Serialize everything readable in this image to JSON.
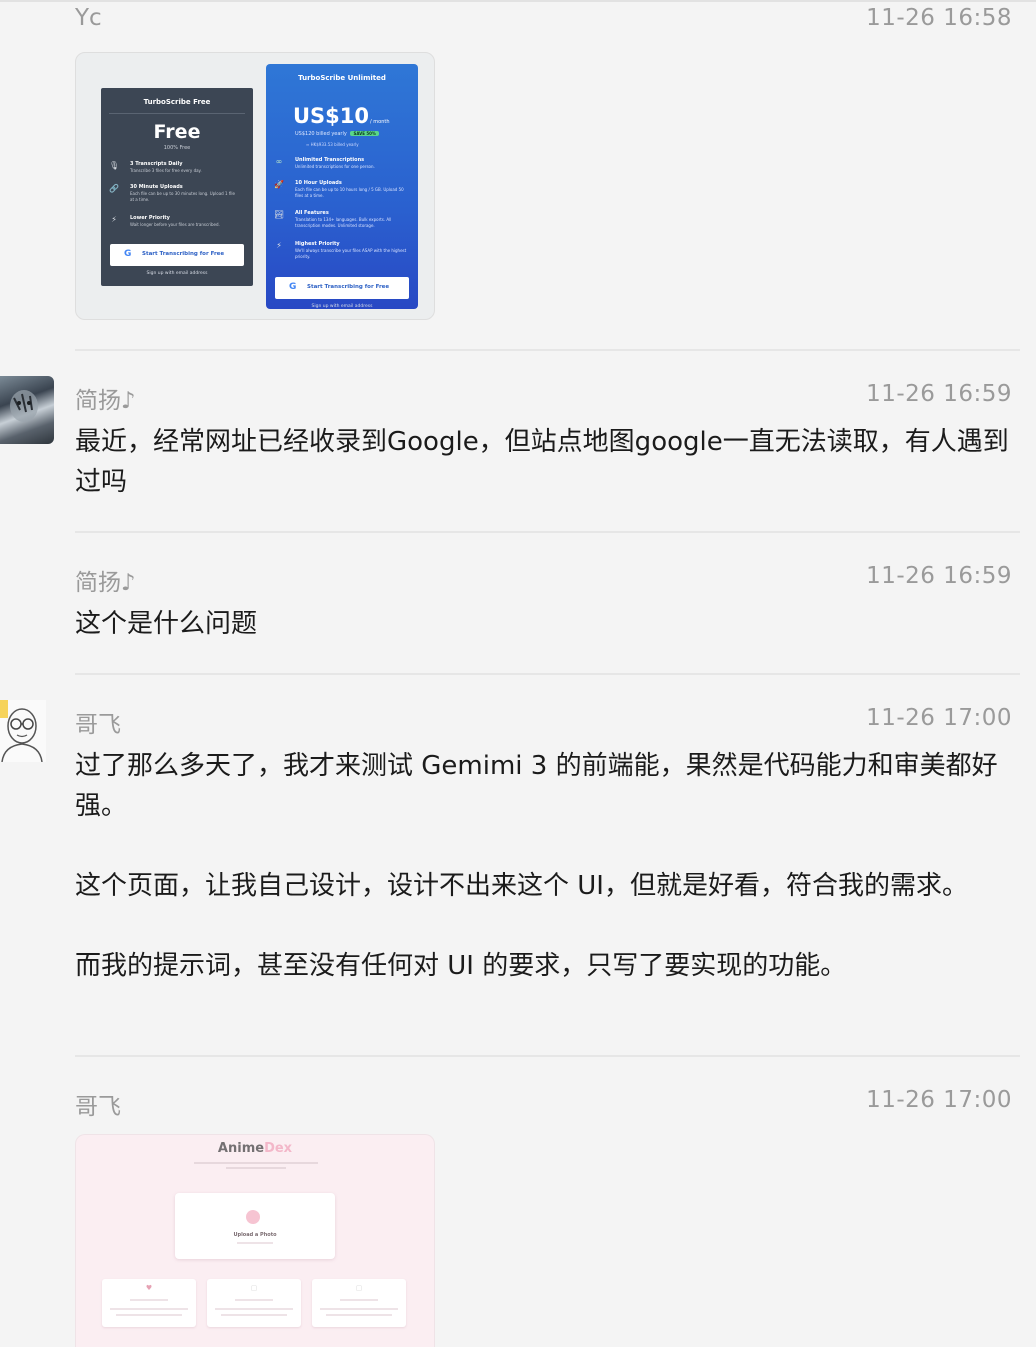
{
  "messages": [
    {
      "sender": "Yc",
      "time": "11-26 16:58",
      "image": {
        "free_card": {
          "title": "TurboScribe Free",
          "plan": "Free",
          "subtitle": "100% Free",
          "features": [
            {
              "icon": "microphone-icon",
              "glyph": "🎙",
              "title": "3 Transcripts Daily",
              "desc": "Transcribe 3 files for free every day."
            },
            {
              "icon": "link-icon",
              "glyph": "🔗",
              "title": "30 Minute Uploads",
              "desc": "Each file can be up to 30 minutes long. Upload 1 file at a time."
            },
            {
              "icon": "bolt-icon",
              "glyph": "⚡",
              "title": "Lower Priority",
              "desc": "Wait longer before your files are transcribed."
            }
          ],
          "button": "Start Transcribing for Free",
          "signup": "Sign up with email address"
        },
        "unlimited_card": {
          "title": "TurboScribe Unlimited",
          "price": "US$10",
          "per": "/ month",
          "billed": "US$120 billed yearly",
          "save_badge": "SAVE 50%",
          "hk": "≈ HK$933.53 billed yearly",
          "features": [
            {
              "icon": "infinity-icon",
              "glyph": "∞",
              "title": "Unlimited Transcriptions",
              "desc": "Unlimited transcriptions for one person."
            },
            {
              "icon": "rocket-icon",
              "glyph": "🚀",
              "title": "10 Hour Uploads",
              "desc": "Each file can be up to 10 hours long / 5 GB. Upload 50 files at a time."
            },
            {
              "icon": "landscape-icon",
              "glyph": "🏞",
              "title": "All Features",
              "desc": "Translation to 134+ languages. Bulk exports. All transcription modes. Unlimited storage."
            },
            {
              "icon": "bolt-icon",
              "glyph": "⚡",
              "title": "Highest Priority",
              "desc": "We'll always transcribe your files ASAP with the highest priority."
            }
          ],
          "button": "Start Transcribing for Free",
          "signup": "Sign up with email address"
        }
      }
    },
    {
      "sender": "简扬♪",
      "time": "11-26 16:59",
      "text": "最近，经常网址已经收录到Google，但站点地图google一直无法读取，有人遇到过吗"
    },
    {
      "sender": "简扬♪",
      "time": "11-26 16:59",
      "text": "这个是什么问题"
    },
    {
      "sender": "哥飞",
      "time": "11-26 17:00",
      "paragraphs": [
        "过了那么多天了，我才来测试 Gemimi 3 的前端能，果然是代码能力和审美都好强。",
        "这个页面，让我自己设计，设计不出来这个 UI，但就是好看，符合我的需求。",
        "而我的提示词，甚至没有任何对 UI 的要求，只写了要实现的功能。"
      ]
    },
    {
      "sender": "哥飞",
      "time": "11-26 17:00",
      "image": {
        "title_main": "Anime",
        "title_accent": "Dex",
        "subtitle": "",
        "upload_title": "Upload a Photo",
        "upload_sub": "",
        "cards": [
          "",
          "",
          ""
        ]
      }
    }
  ],
  "colors": {
    "background": "#f4f4f4",
    "meta_text": "#9a9a9a",
    "body_text": "#1b1b1b",
    "divider": "#e6e6e6",
    "free_card": "#3c4654",
    "unlimited_card": "#2a60cf",
    "google_blue": "#4285f4"
  }
}
